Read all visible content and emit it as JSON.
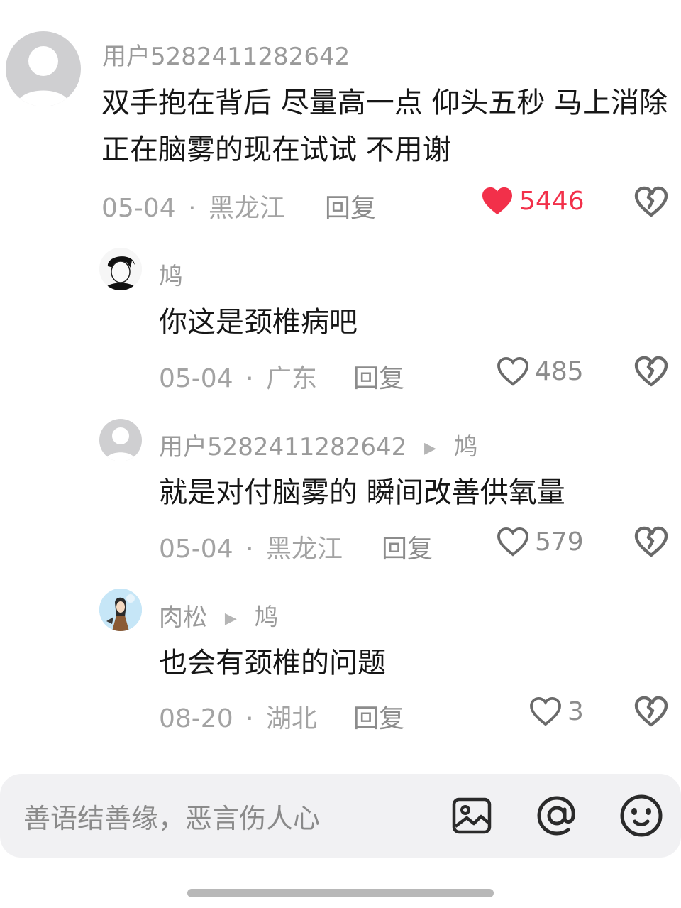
{
  "comments": [
    {
      "username": "用户5282411282642",
      "text": "双手抱在背后 尽量高一点 仰头五秒 马上消除  正在脑雾的现在试试 不用谢",
      "date": "05-04",
      "location": "黑龙江",
      "reply_label": "回复",
      "likes": "5446",
      "liked": true
    },
    {
      "username": "鸠",
      "text": "你这是颈椎病吧",
      "date": "05-04",
      "location": "广东",
      "reply_label": "回复",
      "likes": "485",
      "liked": false
    },
    {
      "username": "用户5282411282642",
      "reply_to": "鸠",
      "text": "就是对付脑雾的 瞬间改善供氧量",
      "date": "05-04",
      "location": "黑龙江",
      "reply_label": "回复",
      "likes": "579",
      "liked": false
    },
    {
      "username": "肉松",
      "reply_to": "鸠",
      "text": "也会有颈椎的问题",
      "date": "08-20",
      "location": "湖北",
      "reply_label": "回复",
      "likes": "3",
      "liked": false
    }
  ],
  "meta_separator": "·",
  "input": {
    "placeholder": "善语结善缘，恶言伤人心",
    "icons": [
      "image-icon",
      "at-icon",
      "emoji-icon"
    ]
  },
  "colors": {
    "liked_red": "#f2304a",
    "meta_gray": "#a3a3a3",
    "input_bg": "#f1f1f3"
  }
}
